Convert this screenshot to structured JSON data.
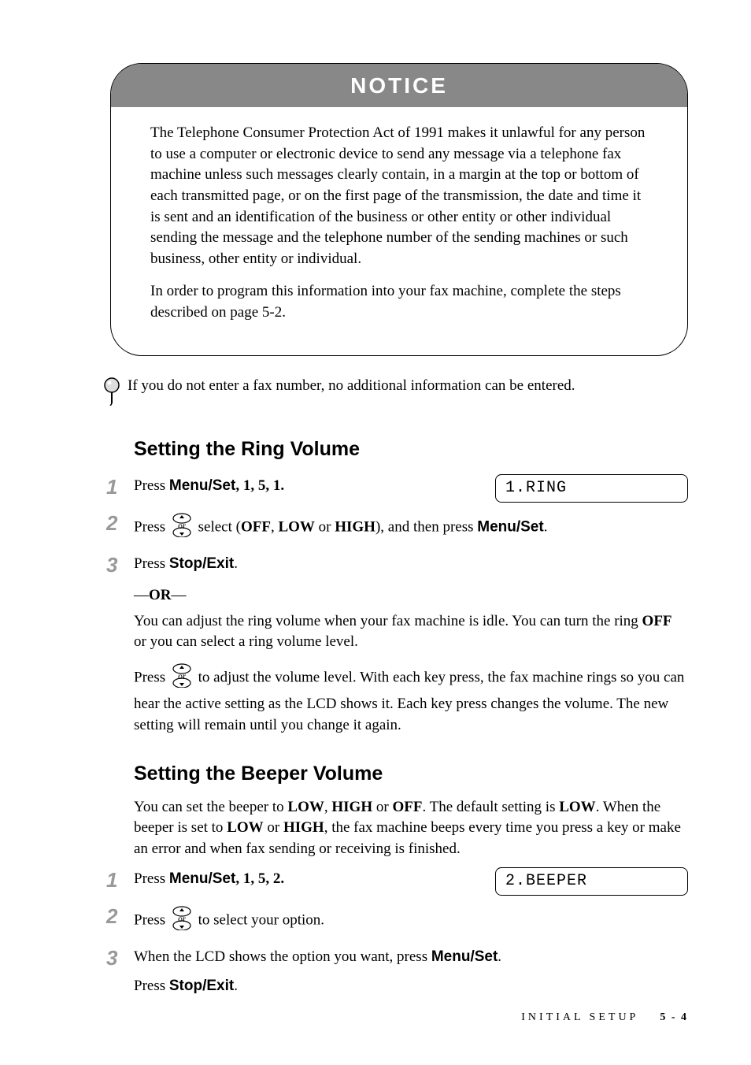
{
  "notice": {
    "title": "NOTICE",
    "para1": "The Telephone Consumer Protection Act of 1991 makes it unlawful for any person to use a computer or electronic device to send any message via a telephone fax machine unless such messages clearly contain, in a margin at the top or bottom of each transmitted page, or on the first page of the transmission, the date and time it is sent and an identification of the business or other entity or other individual sending the message and the telephone number of the sending machines or such business, other entity or individual.",
    "para2": "In order to program this information into your fax machine, complete the steps described on page 5-2."
  },
  "tip": "If you do not enter a fax number, no additional information can be entered.",
  "section_ring": {
    "heading": "Setting the Ring Volume",
    "step1_prefix": "Press ",
    "step1_button": "Menu/Set",
    "step1_seq": ", 1, 5, 1.",
    "step1_lcd": "1.RING",
    "step2_prefix": "Press ",
    "step2_mid": " select (",
    "step2_off": "OFF",
    "step2_sep1": ", ",
    "step2_low": "LOW",
    "step2_sep2": " or ",
    "step2_high": "HIGH",
    "step2_close": "), and then press ",
    "step2_button": "Menu/Set",
    "step2_end": ".",
    "step3_prefix": "Press ",
    "step3_button": "Stop/Exit",
    "step3_end": ".",
    "or_dash": "—",
    "or_text": "OR",
    "body1a": "You can adjust the ring volume when your fax machine is idle. You can turn the ring ",
    "body1_off": "OFF",
    "body1b": " or you can select a ring volume level.",
    "body2_prefix": "Press ",
    "body2_mid": " to adjust the volume level. With each key press, the fax machine rings so you can hear the active setting as the LCD shows it. Each key press changes the volume. The new setting will remain until you change it again."
  },
  "section_beeper": {
    "heading": "Setting the Beeper Volume",
    "intro_a": "You can set the beeper to ",
    "low": "LOW",
    "sep1": ", ",
    "high": "HIGH",
    "sep2": " or ",
    "off": "OFF",
    "intro_b": ". The default setting is ",
    "low2": "LOW",
    "intro_c": ". When the beeper is set to ",
    "low3": "LOW",
    "sep3": " or ",
    "high2": "HIGH",
    "intro_d": ", the fax machine beeps every time you press a key or make an error and when fax sending or receiving is finished.",
    "step1_prefix": "Press ",
    "step1_button": "Menu/Set",
    "step1_seq": ", 1, 5, 2.",
    "step1_lcd": "2.BEEPER",
    "step2_prefix": "Press ",
    "step2_mid": " to select your option.",
    "step3_prefix": "When the LCD shows the option you want, press ",
    "step3_button": "Menu/Set",
    "step3_end": ".",
    "step3b_prefix": "Press ",
    "step3b_button": "Stop/Exit",
    "step3b_end": "."
  },
  "nums": {
    "n1": "1",
    "n2": "2",
    "n3": "3"
  },
  "footer": {
    "label": "INITIAL SETUP",
    "page": "5 - 4"
  },
  "icons": {
    "or_label": "or"
  }
}
